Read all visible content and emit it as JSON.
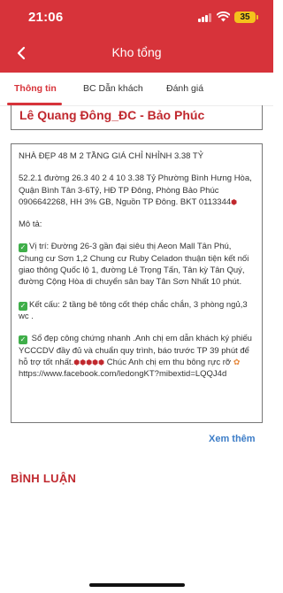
{
  "status_bar": {
    "time": "21:06",
    "battery": "35"
  },
  "header": {
    "title": "Kho tổng"
  },
  "tabs": [
    {
      "label": "Thông tin",
      "active": true
    },
    {
      "label": "BC Dẫn khách",
      "active": false
    },
    {
      "label": "Đánh giá",
      "active": false
    }
  ],
  "author": {
    "name": "Lê Quang Đông_ĐC - Bảo Phúc"
  },
  "listing": {
    "headline": "NHÀ ĐẸP 48 M  2 TẦNG GIÁ CHỈ NHỈNH 3.38 TỶ",
    "summary": "52.2.1 đường 26.3 40 2 4 10 3.38 Tỷ  Phường Bình Hưng Hòa, Quận Bình Tân 3-6Tỷ, HĐ TP Đông, Phòng Bảo Phúc 0906642268, HH 3% GB, Nguồn TP Đông. BKT 0113344",
    "desc_label": "Mô tả:",
    "location": "Vị trí: Đường 26-3   gần đại siêu thị Aeon Mall Tân Phú, Chung cư Sơn 1,2 Chung cư Ruby Celadon thuận tiện kết nối giao thông Quốc lộ 1, đường Lê Trọng Tấn, Tân kỳ Tân Quý, đường Cộng Hòa di chuyển sân bay Tân Sơn Nhất 10 phút.",
    "structure": "Kết cấu: 2 tầng bê tông cốt thép chắc chắn, 3 phòng ngủ,3 wc .",
    "ownership": " Sổ đẹp công chứng nhanh .Anh chị em dẫn khách ký phiếu YCCCDV đầy đủ và chuẩn quy trình, báo trước TP 39 phút để hỗ trợ tốt nhất.",
    "closing": " Chúc Anh chị em thu bông rực rỡ ",
    "link": "https://www.facebook.com/ledongKT?mibextid=LQQJ4d"
  },
  "see_more": "Xem thêm",
  "comments": {
    "title": "BÌNH LUẬN"
  },
  "colors": {
    "brand_red": "#d7333a",
    "name_red": "#c0282e",
    "link_blue": "#3b7cc7",
    "check_green": "#3fae49"
  },
  "icons": {
    "back": "chevron-left-icon",
    "check": "check-box-icon",
    "mark": "red-marker-icon"
  }
}
